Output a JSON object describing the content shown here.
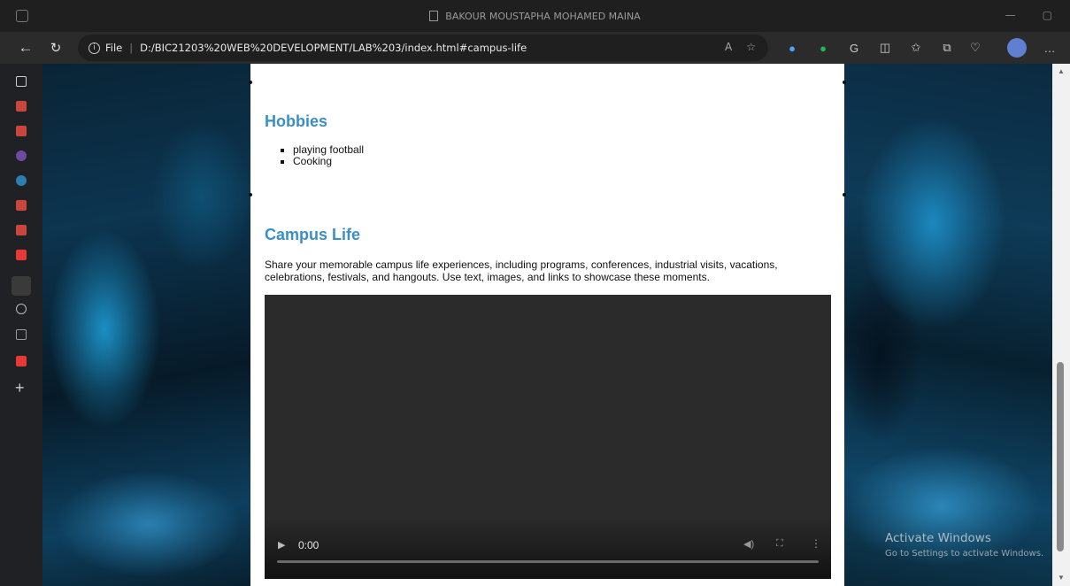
{
  "window": {
    "title": "BAKOUR MOUSTAPHA MOHAMED MAINA"
  },
  "addressbar": {
    "back_icon": "back-arrow-icon",
    "refresh_icon": "refresh-icon",
    "info_label": "File",
    "url": "D:/BIC21203%20WEB%20DEVELOPMENT/LAB%203/index.html#campus-life"
  },
  "page": {
    "hobbies": {
      "title": "Hobbies",
      "items": [
        "playing football",
        "Cooking"
      ]
    },
    "campus": {
      "title": "Campus Life",
      "text": "Share your memorable campus life experiences, including programs, conferences, industrial visits, vacations, celebrations, festivals, and hangouts. Use text, images, and links to showcase these moments."
    },
    "video": {
      "time": "0:00"
    }
  },
  "watermark": {
    "line1": "Activate Windows",
    "line2": "Go to Settings to activate Windows."
  },
  "colors": {
    "heading": "#3a8ec9",
    "browser_chrome": "#2b2b2b"
  }
}
